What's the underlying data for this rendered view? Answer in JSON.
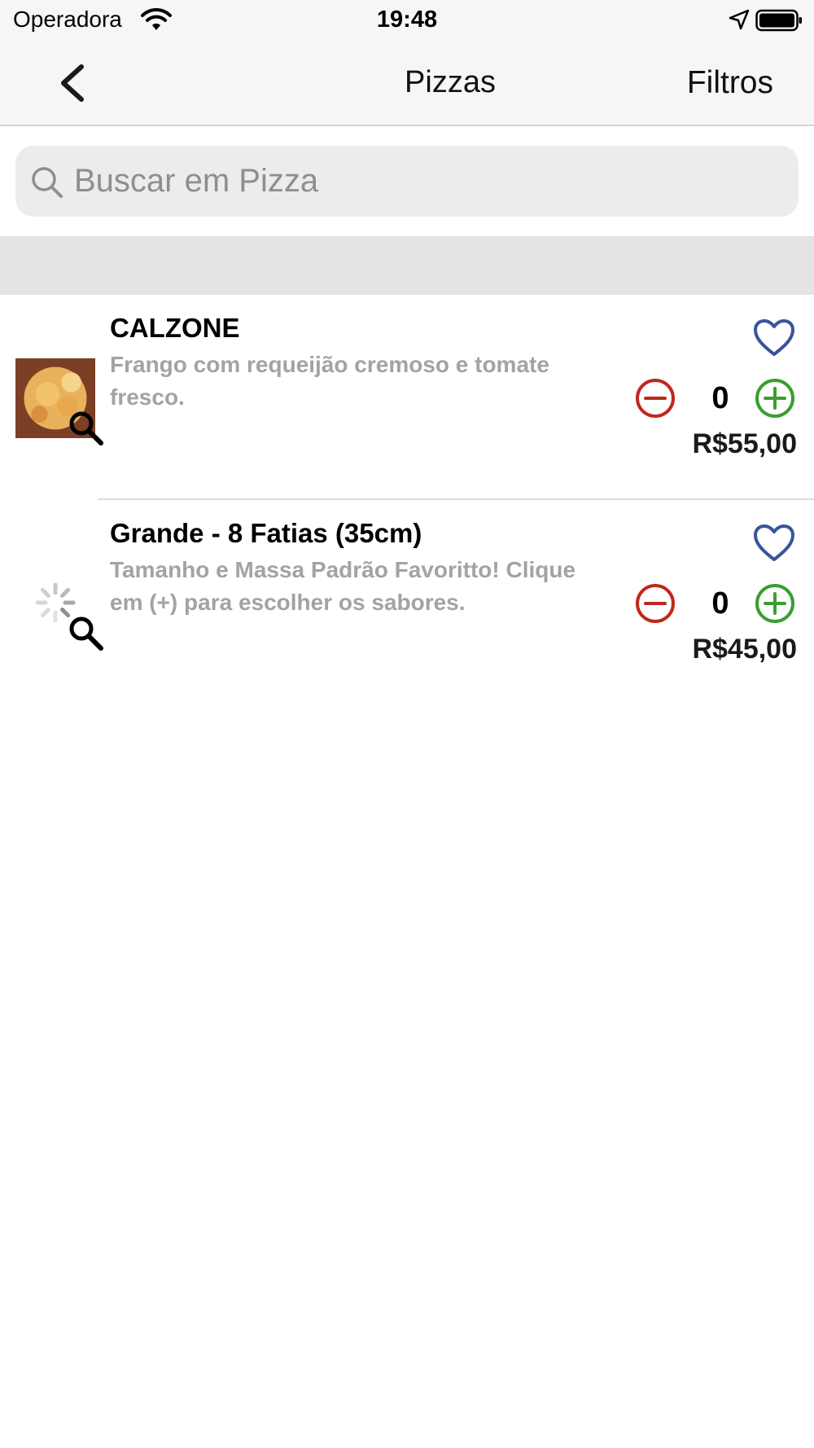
{
  "status_bar": {
    "carrier": "Operadora",
    "time": "19:48",
    "wifi_icon": "wifi-icon",
    "location_icon": "location-arrow-icon",
    "battery_icon": "battery-full-icon"
  },
  "nav": {
    "back_icon": "chevron-left-icon",
    "title": "Pizzas",
    "filter_label": "Filtros"
  },
  "search": {
    "placeholder": "Buscar em Pizza",
    "value": ""
  },
  "items": [
    {
      "title": "CALZONE",
      "description": "Frango com requeijão cremoso e tomate fresco.",
      "quantity": "0",
      "price": "R$55,00",
      "image": "calzone-photo"
    },
    {
      "title": "Grande - 8 Fatias (35cm)",
      "description": "Tamanho e Massa Padrão Favoritto! Clique em (+) para escolher os sabores.",
      "quantity": "0",
      "price": "R$45,00",
      "image": "loading-spinner"
    }
  ],
  "colors": {
    "minus": "#c0281b",
    "plus": "#3a9e2f",
    "heart": "#3a539b",
    "description": "#a3a3a3"
  }
}
